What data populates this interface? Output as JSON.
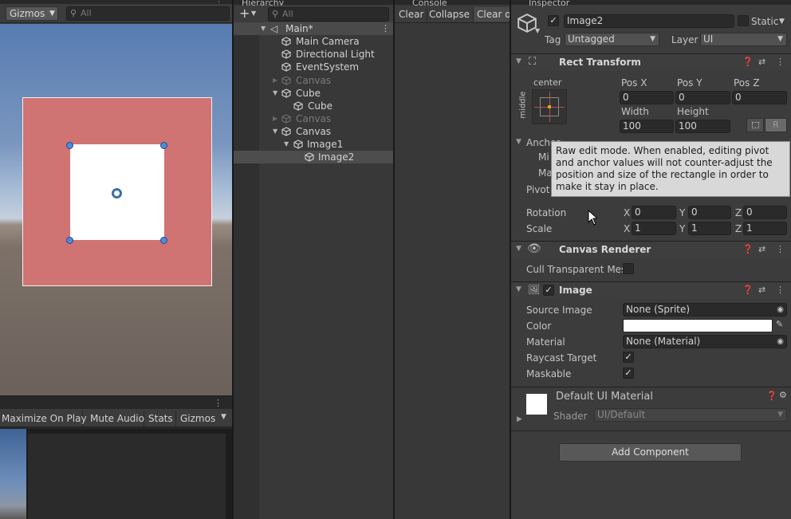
{
  "scene": {
    "gizmos_label": "Gizmos",
    "search_placeholder": "All"
  },
  "game": {
    "buttons": [
      "Maximize On Play",
      "Mute Audio",
      "Stats",
      "Gizmos"
    ]
  },
  "hierarchy": {
    "tab_label": "Hierarchy",
    "search_placeholder": "All",
    "add_label": "+",
    "scene_name": "Main*",
    "items": [
      {
        "label": "Main Camera"
      },
      {
        "label": "Directional Light"
      },
      {
        "label": "EventSystem"
      },
      {
        "label": "Canvas"
      },
      {
        "label": "Cube"
      },
      {
        "label": "Cube"
      },
      {
        "label": "Canvas"
      },
      {
        "label": "Canvas"
      },
      {
        "label": "Image1"
      },
      {
        "label": "Image2"
      }
    ]
  },
  "console": {
    "tab_label": "Console",
    "buttons": [
      "Clear",
      "Collapse",
      "Clear o"
    ]
  },
  "inspector": {
    "tab_label": "Inspector",
    "object_name": "Image2",
    "static_label": "Static",
    "tag_label": "Tag",
    "tag_value": "Untagged",
    "layer_label": "Layer",
    "layer_value": "UI",
    "rect_transform": {
      "title": "Rect Transform",
      "anchor_h": "center",
      "anchor_v": "middle",
      "pos_x_label": "Pos X",
      "pos_x": "0",
      "pos_y_label": "Pos Y",
      "pos_y": "0",
      "pos_z_label": "Pos Z",
      "pos_z": "0",
      "width_label": "Width",
      "width": "100",
      "height_label": "Height",
      "height": "100",
      "raw_button": "R",
      "anchors_label": "Anchor",
      "min_label": "Mi",
      "max_label": "Ma",
      "pivot_label": "Pivot",
      "rotation_label": "Rotation",
      "rotation": {
        "x": "0",
        "y": "0",
        "z": "0"
      },
      "scale_label": "Scale",
      "scale": {
        "x": "1",
        "y": "1",
        "z": "1"
      },
      "x": "X",
      "y": "Y",
      "z": "Z"
    },
    "tooltip": "Raw edit mode. When enabled, editing pivot and anchor values will not counter-adjust the position and size of the rectangle in order to make it stay in place.",
    "canvas_renderer": {
      "title": "Canvas Renderer",
      "cull_label": "Cull Transparent Mes"
    },
    "image": {
      "title": "Image",
      "source_image_label": "Source Image",
      "source_image_value": "None (Sprite)",
      "color_label": "Color",
      "material_label": "Material",
      "material_value": "None (Material)",
      "raycast_label": "Raycast Target",
      "maskable_label": "Maskable",
      "check": "✓"
    },
    "material": {
      "name": "Default UI Material",
      "shader_label": "Shader",
      "shader_value": "UI/Default"
    },
    "add_component": "Add Component"
  },
  "colors": {
    "canvas_fill": "#d07373",
    "image_fill": "#ffffff",
    "handle": "#4e8bdc",
    "selection": "#4d4d4d"
  }
}
